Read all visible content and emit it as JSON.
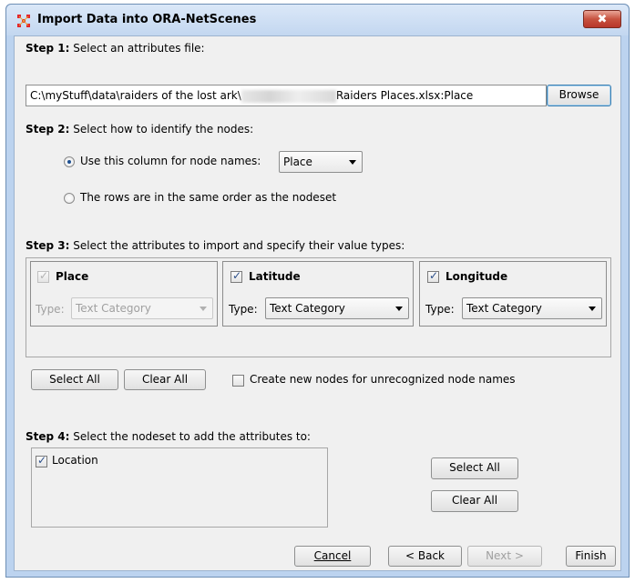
{
  "dialog": {
    "title": "Import Data into ORA-NetScenes",
    "close_label": "✖"
  },
  "step1": {
    "label_bold": "Step 1:",
    "label_text": "Select an attributes file:",
    "path_prefix": "C:\\myStuff\\data\\raiders of the lost ark\\",
    "path_suffix": "Raiders Places.xlsx:Place",
    "browse_label": "Browse"
  },
  "step2": {
    "label_bold": "Step 2:",
    "label_text": "Select how to identify the nodes:",
    "option_column_label": "Use this column for node names:",
    "column_value": "Place",
    "option_rows_label": "The rows are in the same order as the nodeset"
  },
  "step3": {
    "label_bold": "Step 3:",
    "label_text": "Select the attributes to import and specify their value types:",
    "attributes": [
      {
        "name": "Place",
        "type_label": "Type:",
        "type_value": "Text Category",
        "checked": true,
        "enabled": false
      },
      {
        "name": "Latitude",
        "type_label": "Type:",
        "type_value": "Text Category",
        "checked": true,
        "enabled": true
      },
      {
        "name": "Longitude",
        "type_label": "Type:",
        "type_value": "Text Category",
        "checked": true,
        "enabled": true
      }
    ],
    "select_all_label": "Select All",
    "clear_all_label": "Clear All",
    "create_nodes_label": "Create new nodes for unrecognized node names"
  },
  "step4": {
    "label_bold": "Step 4:",
    "label_text": "Select the nodeset to add the attributes to:",
    "nodesets": [
      {
        "name": "Location",
        "checked": true
      }
    ],
    "select_all_label": "Select All",
    "clear_all_label": "Clear All"
  },
  "footer": {
    "cancel_label": "Cancel",
    "back_label": "< Back",
    "next_label": "Next >",
    "finish_label": "Finish"
  }
}
